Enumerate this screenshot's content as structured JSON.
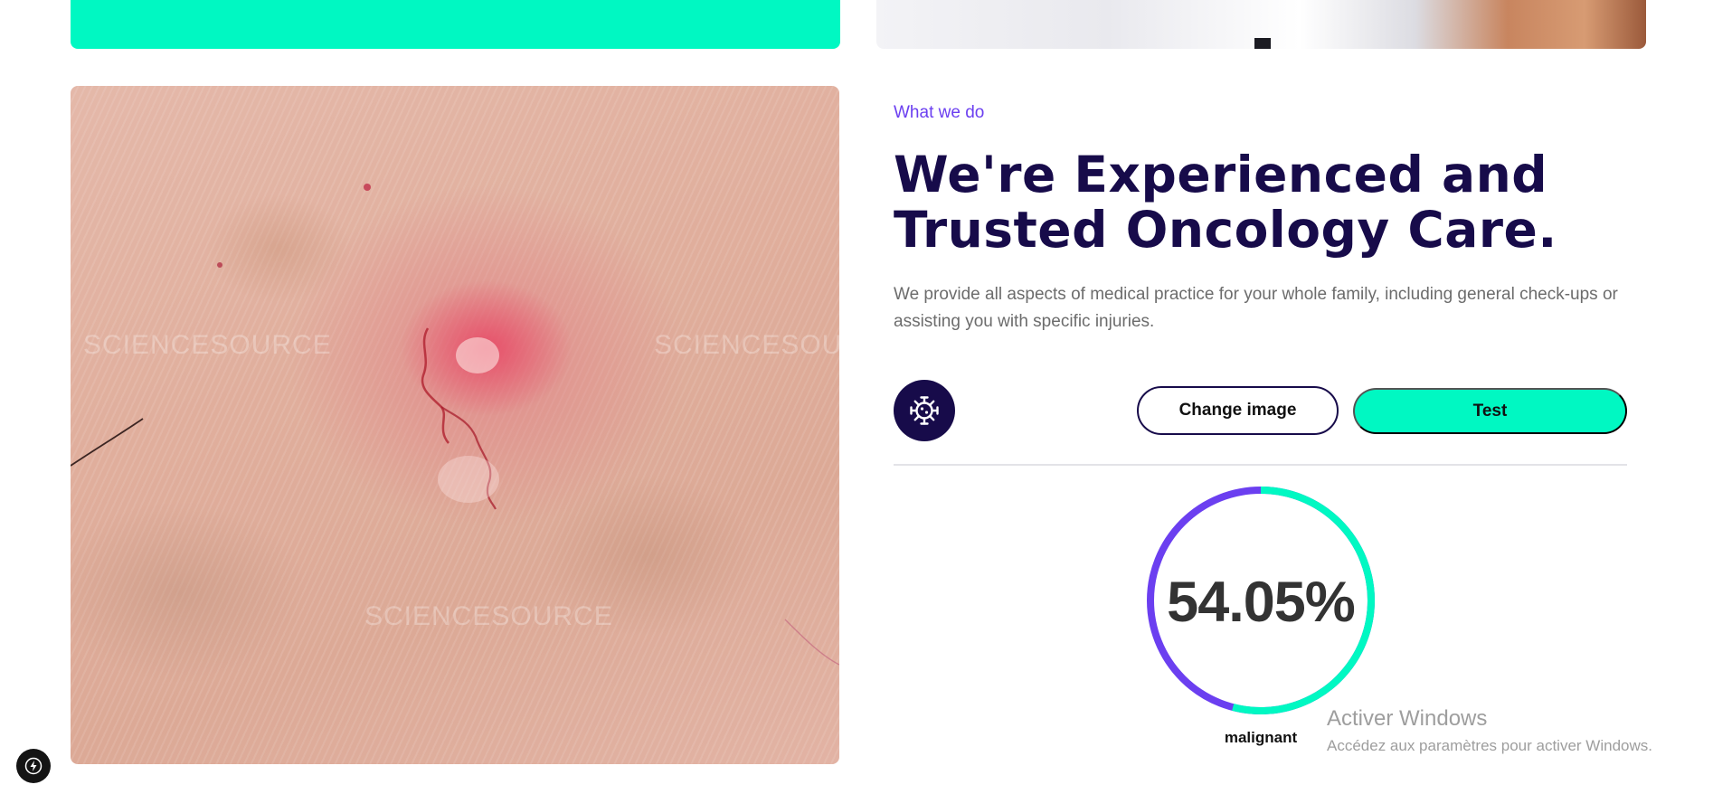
{
  "section": {
    "eyebrow": "What we do",
    "title": "We're Experienced and Trusted Oncology Care.",
    "description": "We provide all aspects of medical practice for your whole family, including general check-ups or assisting you with specific injuries."
  },
  "image": {
    "watermark_text": "SCIENCESOURCE"
  },
  "actions": {
    "change_image_label": "Change image",
    "test_label": "Test",
    "virus_icon": "virus-icon"
  },
  "result": {
    "value_text": "54.05%",
    "value": 54.05,
    "label": "malignant",
    "colors": {
      "primary": "#00f8c2",
      "secondary": "#6b3ff0"
    }
  },
  "overlay": {
    "activate_title": "Activer Windows",
    "activate_subtitle": "Accédez aux paramètres pour activer Windows."
  },
  "colors": {
    "accent_green": "#00f8c2",
    "navy": "#170b4a",
    "purple": "#6b3ff0"
  }
}
